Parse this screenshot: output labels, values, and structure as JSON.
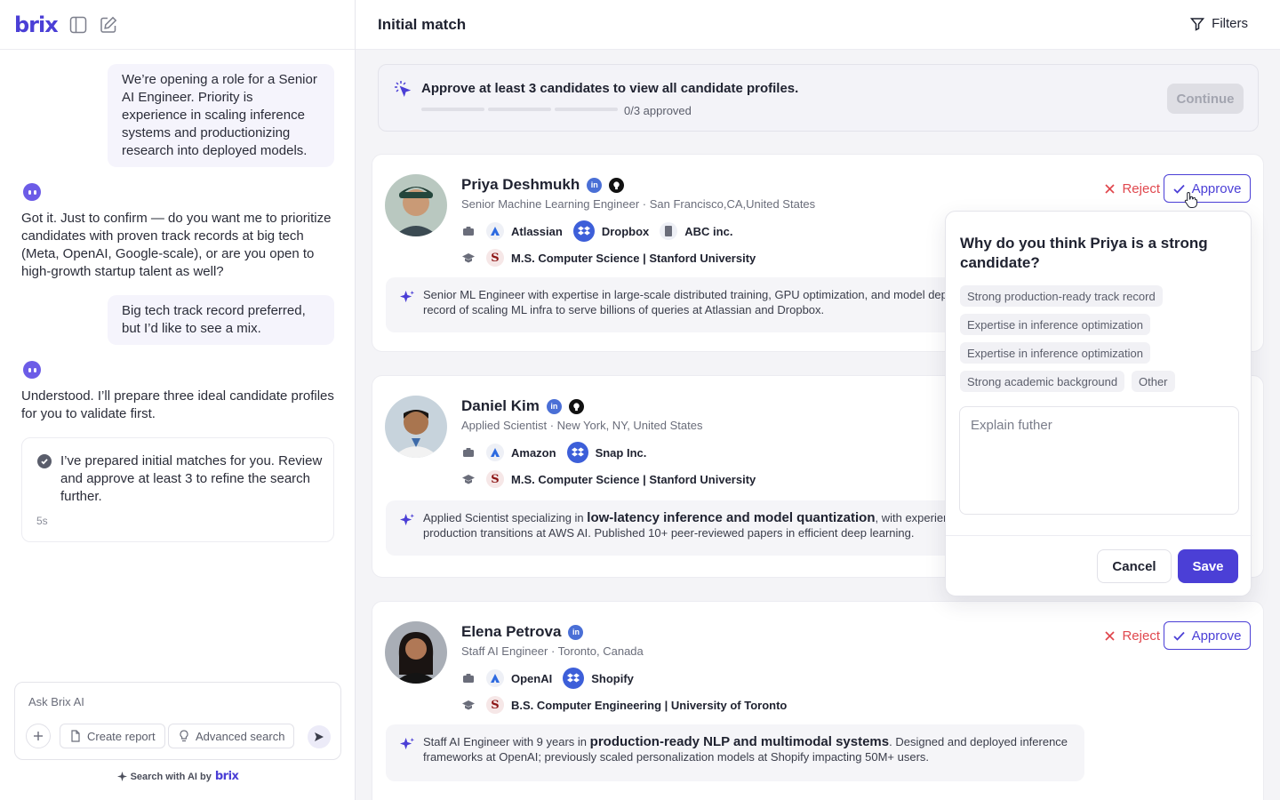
{
  "sidebar": {
    "logo": "brix",
    "messages": {
      "user1": "We’re opening a role for a Senior AI Engineer. Priority is experience in scaling inference systems and productionizing research into deployed models.",
      "bot1": "Got it. Just to confirm — do you want me to prioritize candidates with proven track records at big tech (Meta, OpenAI, Google-scale), or are you open to high-growth startup talent as well?",
      "user2": "Big tech track record preferred, but I’d like to see a mix.",
      "bot2": "Understood. I’ll prepare three ideal candidate profiles for you to validate first.",
      "status": "I’ve prepared initial matches for you. Review and approve at least 3 to refine the search further.",
      "status_time": "5s"
    },
    "chat": {
      "placeholder": "Ask Brix AI",
      "create_report": "Create report",
      "advanced_search": "Advanced search"
    },
    "powered_by": "Search with AI by",
    "powered_brand": "brix"
  },
  "header": {
    "title": "Initial match",
    "filters": "Filters"
  },
  "banner": {
    "title": "Approve at least 3 candidates to view all candidate profiles.",
    "progress_text": "0/3 approved",
    "approved": 0,
    "required": 3,
    "continue": "Continue"
  },
  "actions": {
    "reject": "Reject",
    "approve": "Approve"
  },
  "candidates": [
    {
      "name": "Priya Deshmukh",
      "subtitle": "Senior Machine Learning Engineer · San Francisco,CA,United States",
      "companies": [
        "Atlassian",
        "Dropbox",
        "ABC inc."
      ],
      "education": "M.S. Computer Science | Stanford University",
      "summary": "Senior ML Engineer with expertise in large-scale distributed training, GPU optimization, and model deployment. Proven track record of scaling ML infra to serve billions of queries at Atlassian and Dropbox."
    },
    {
      "name": "Daniel Kim",
      "subtitle": "Applied Scientist · New York, NY, United States",
      "companies": [
        "Amazon",
        "Snap Inc."
      ],
      "education": "M.S. Computer Science | Stanford University",
      "summary_pre": "Applied Scientist specializing in ",
      "summary_bold": "low-latency inference and model quantization",
      "summary_post": ", with experience leading research-to-production transitions at AWS AI. Published 10+ peer-reviewed papers in efficient deep learning."
    },
    {
      "name": "Elena Petrova",
      "subtitle": "Staff AI Engineer · Toronto, Canada",
      "companies": [
        "OpenAI",
        "Shopify"
      ],
      "education": "B.S. Computer Engineering | University of Toronto",
      "summary_pre": "Staff AI Engineer with 9 years in ",
      "summary_bold": "production-ready NLP and multimodal systems",
      "summary_post": ". Designed and deployed inference frameworks at OpenAI; previously scaled personalization models at Shopify impacting 50M+ users."
    }
  ],
  "popover": {
    "title": "Why do you think Priya is a strong candidate?",
    "chips": [
      "Strong production-ready track record",
      "Expertise in inference optimization",
      "Expertise in inference optimization",
      "Strong academic background",
      "Other"
    ],
    "placeholder": "Explain futher",
    "cancel": "Cancel",
    "save": "Save"
  },
  "colors": {
    "accent": "#4b3fd6",
    "reject": "#e0484e"
  }
}
